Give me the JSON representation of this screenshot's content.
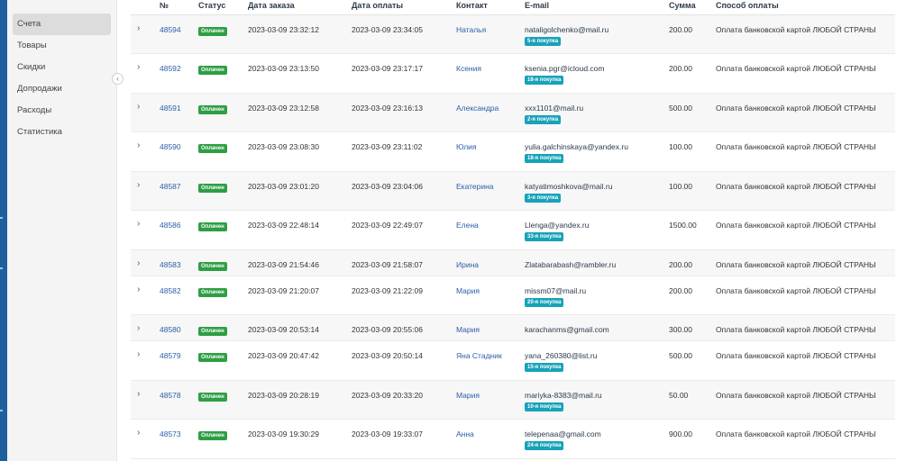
{
  "sidebar": {
    "items": [
      {
        "label": "Счета",
        "active": true
      },
      {
        "label": "Товары",
        "active": false
      },
      {
        "label": "Скидки",
        "active": false
      },
      {
        "label": "Допродажи",
        "active": false
      },
      {
        "label": "Расходы",
        "active": false
      },
      {
        "label": "Статистика",
        "active": false
      }
    ],
    "collapse_icon": "‹"
  },
  "table": {
    "headers": [
      "№",
      "Статус",
      "Дата заказа",
      "Дата оплаты",
      "Контакт",
      "E-mail",
      "Сумма",
      "Способ оплаты"
    ],
    "rows": [
      {
        "id": "48594",
        "status": "Оплачен",
        "order_date": "2023-03-09 23:32:12",
        "pay_date": "2023-03-09 23:34:05",
        "contact": "Наталья",
        "email": "nataligolchenko@mail.ru",
        "purchase": "5-я покупка",
        "sum": "200.00",
        "method": "Оплата банковской картой ЛЮБОЙ СТРАНЫ"
      },
      {
        "id": "48592",
        "status": "Оплачен",
        "order_date": "2023-03-09 23:13:50",
        "pay_date": "2023-03-09 23:17:17",
        "contact": "Ксения",
        "email": "ksenia.pgr@icloud.com",
        "purchase": "18-я покупка",
        "sum": "200.00",
        "method": "Оплата банковской картой ЛЮБОЙ СТРАНЫ"
      },
      {
        "id": "48591",
        "status": "Оплачен",
        "order_date": "2023-03-09 23:12:58",
        "pay_date": "2023-03-09 23:16:13",
        "contact": "Александра",
        "email": "xxx1101@mail.ru",
        "purchase": "2-я покупка",
        "sum": "500.00",
        "method": "Оплата банковской картой ЛЮБОЙ СТРАНЫ"
      },
      {
        "id": "48590",
        "status": "Оплачен",
        "order_date": "2023-03-09 23:08:30",
        "pay_date": "2023-03-09 23:11:02",
        "contact": "Юлия",
        "email": "yulia.galchinskaya@yandex.ru",
        "purchase": "18-я покупка",
        "sum": "100.00",
        "method": "Оплата банковской картой ЛЮБОЙ СТРАНЫ"
      },
      {
        "id": "48587",
        "status": "Оплачен",
        "order_date": "2023-03-09 23:01:20",
        "pay_date": "2023-03-09 23:04:06",
        "contact": "Екатерина",
        "email": "katyatimoshkova@mail.ru",
        "purchase": "3-я покупка",
        "sum": "100.00",
        "method": "Оплата банковской картой ЛЮБОЙ СТРАНЫ"
      },
      {
        "id": "48586",
        "status": "Оплачен",
        "order_date": "2023-03-09 22:48:14",
        "pay_date": "2023-03-09 22:49:07",
        "contact": "Елена",
        "email": "Llenga@yandex.ru",
        "purchase": "33-я покупка",
        "sum": "1500.00",
        "method": "Оплата банковской картой ЛЮБОЙ СТРАНЫ"
      },
      {
        "id": "48583",
        "status": "Оплачен",
        "order_date": "2023-03-09 21:54:46",
        "pay_date": "2023-03-09 21:58:07",
        "contact": "Ирина",
        "email": "Zlatabarabash@rambler.ru",
        "purchase": "",
        "sum": "200.00",
        "method": "Оплата банковской картой ЛЮБОЙ СТРАНЫ"
      },
      {
        "id": "48582",
        "status": "Оплачен",
        "order_date": "2023-03-09 21:20:07",
        "pay_date": "2023-03-09 21:22:09",
        "contact": "Мария",
        "email": "missm07@mail.ru",
        "purchase": "20-я покупка",
        "sum": "200.00",
        "method": "Оплата банковской картой ЛЮБОЙ СТРАНЫ"
      },
      {
        "id": "48580",
        "status": "Оплачен",
        "order_date": "2023-03-09 20:53:14",
        "pay_date": "2023-03-09 20:55:06",
        "contact": "Мария",
        "email": "karachanms@gmail.com",
        "purchase": "",
        "sum": "300.00",
        "method": "Оплата банковской картой ЛЮБОЙ СТРАНЫ"
      },
      {
        "id": "48579",
        "status": "Оплачен",
        "order_date": "2023-03-09 20:47:42",
        "pay_date": "2023-03-09 20:50:14",
        "contact": "Яна Стадник",
        "email": "yana_260380@list.ru",
        "purchase": "15-я покупка",
        "sum": "500.00",
        "method": "Оплата банковской картой ЛЮБОЙ СТРАНЫ"
      },
      {
        "id": "48578",
        "status": "Оплачен",
        "order_date": "2023-03-09 20:28:19",
        "pay_date": "2023-03-09 20:33:20",
        "contact": "Мария",
        "email": "mariyka-8383@mail.ru",
        "purchase": "10-я покупка",
        "sum": "50.00",
        "method": "Оплата банковской картой ЛЮБОЙ СТРАНЫ"
      },
      {
        "id": "48573",
        "status": "Оплачен",
        "order_date": "2023-03-09 19:30:29",
        "pay_date": "2023-03-09 19:33:07",
        "contact": "Анна",
        "email": "telepenaa@gmail.com",
        "purchase": "24-я покупка",
        "sum": "900.00",
        "method": "Оплата банковской картой ЛЮБОЙ СТРАНЫ"
      }
    ]
  },
  "icons": {
    "expand": "›"
  },
  "colors": {
    "status": "#2e9e44",
    "purchase": "#17a2b8",
    "link": "#2a5ea8",
    "strip": "#1f5fa0"
  }
}
